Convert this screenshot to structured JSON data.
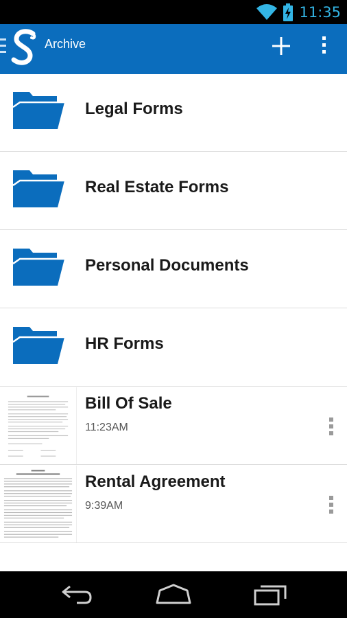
{
  "status": {
    "time": "11:35"
  },
  "app": {
    "title": "Archive"
  },
  "colors": {
    "accent": "#0b6dbd",
    "status_accent": "#33b5e5",
    "folder": "#0b6dbd"
  },
  "folders": [
    {
      "name": "Legal Forms"
    },
    {
      "name": "Real Estate Forms"
    },
    {
      "name": "Personal Documents"
    },
    {
      "name": "HR Forms"
    }
  ],
  "documents": [
    {
      "title": "Bill Of Sale",
      "time": "11:23AM"
    },
    {
      "title": "Rental Agreement",
      "time": "9:39AM"
    }
  ],
  "icons": {
    "wifi": "wifi-icon",
    "battery": "battery-charging-icon",
    "add": "plus-icon",
    "overflow": "overflow-menu-icon",
    "folder": "folder-icon",
    "back": "back-icon",
    "home": "home-icon",
    "recents": "recent-apps-icon"
  }
}
